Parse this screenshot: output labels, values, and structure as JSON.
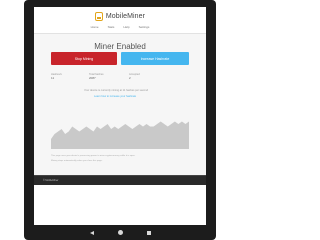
{
  "app": {
    "logo_text": "MobileMiner"
  },
  "nav": [
    "Home",
    "Stats",
    "Help",
    "Settings"
  ],
  "page": {
    "title": "Miner Enabled",
    "stop_button": "Stop Mining",
    "increase_button": "Increase Hashrate"
  },
  "stats": {
    "hashes_label": "Hashes/s",
    "hashes_value": "11",
    "total_label": "Total hashes",
    "total_value": "2087",
    "accepted_label": "Accepted",
    "accepted_value": "2",
    "summary_text": "Your device is currently mining at 11 hashes per second",
    "link_text": "Learn how to increase your hashrate"
  },
  "chart_data": {
    "type": "area",
    "values": [
      4,
      6,
      7,
      8,
      6,
      7,
      9,
      8,
      7,
      8,
      9,
      8,
      7,
      9,
      8,
      9,
      10,
      8,
      9,
      8,
      9,
      10,
      9,
      8,
      9,
      10,
      9,
      10,
      9,
      9,
      10,
      11,
      10,
      9,
      10,
      11,
      10,
      11,
      10,
      11
    ],
    "ylim": [
      0,
      12
    ],
    "color": "#c9c9c9"
  },
  "legal": {
    "line1": "This page uses your device's processing power to mine cryptocurrency while it is open.",
    "line2": "Mining stops automatically when you close this page."
  },
  "footer": {
    "text": "© MobileMiner"
  },
  "colors": {
    "stop": "#c8242b",
    "increase": "#45b6ef",
    "accent": "#e2a51a"
  }
}
